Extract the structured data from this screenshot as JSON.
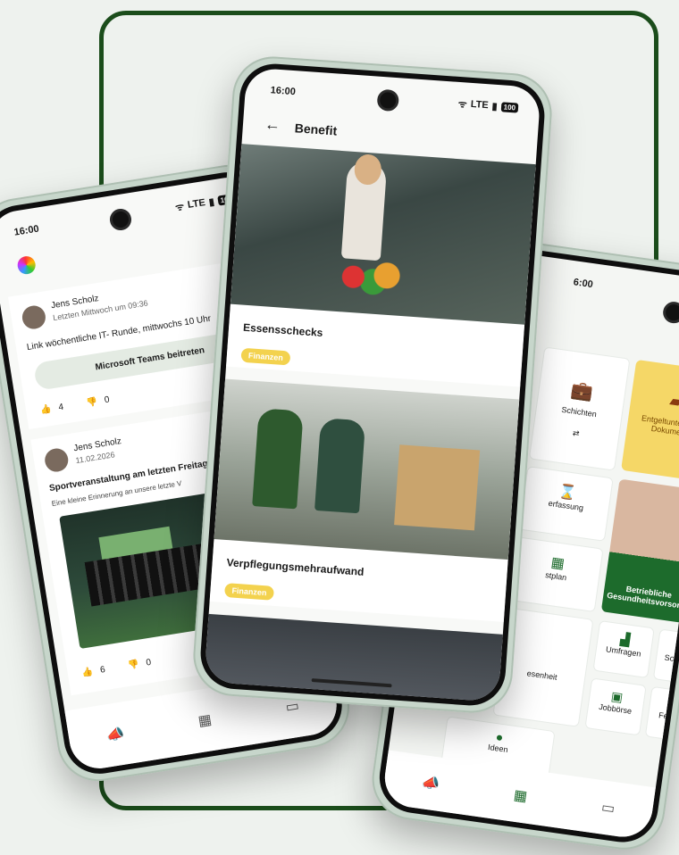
{
  "status": {
    "time": "16:00",
    "net": "LTE",
    "battery": "100"
  },
  "left": {
    "posts": [
      {
        "author": "Jens Scholz",
        "time": "Letzten Mittwoch um 09:36",
        "text": "Link wöchentliche IT- Runde, mittwochs 10 Uhr",
        "button": "Microsoft Teams beitreten",
        "likes": "4",
        "dislikes": "0"
      },
      {
        "author": "Jens Scholz",
        "time": "11.02.2026",
        "title": "Sportveranstaltung am letzten Freitag",
        "excerpt": "Eine kleine Erinnerung an unsere letzte V",
        "likes": "6",
        "dislikes": "0"
      }
    ]
  },
  "middle": {
    "back": "←",
    "title": "Benefit",
    "items": [
      {
        "title": "Essensschecks",
        "tag": "Finanzen"
      },
      {
        "title": "Verpflegungsmehraufwand",
        "tag": "Finanzen"
      }
    ]
  },
  "right": {
    "time": "6:00",
    "tiles": {
      "schichten": "Schichten",
      "entgelt": "Entgeltunterlagen Dokumente",
      "erfassung": "erfassung",
      "dienstplan": "stplan",
      "gesundheit": "Betriebliche Gesundheitsvorsorge",
      "umfragen": "Umfragen",
      "schnelllinks": "Schnelllink",
      "anwesenheit": "esenheit",
      "jobboerse": "Jobbörse",
      "feiertage": "Feiertage",
      "ideen": "Ideen"
    }
  }
}
